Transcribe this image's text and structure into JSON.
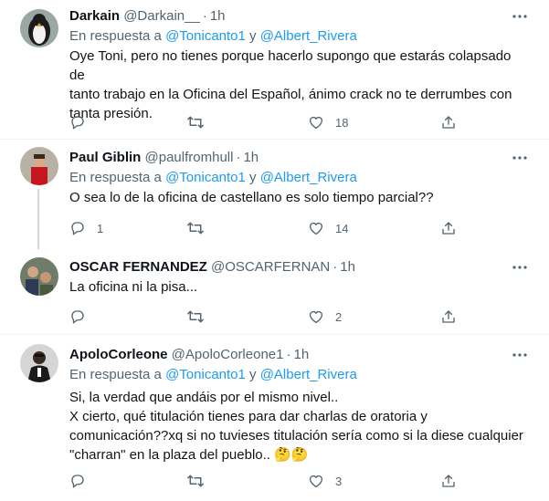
{
  "tweets": [
    {
      "name": "Darkain",
      "handle": "@Darkain__",
      "dot": "·",
      "time": "1h",
      "reply_prefix": "En respuesta a",
      "reply_mention1": "@Tonicanto1",
      "reply_joiner": " y ",
      "reply_mention2": "@Albert_Rivera",
      "lines": [
        "Oye Toni, pero no tienes porque hacerlo supongo que estarás colapsado de",
        "tanto trabajo en la Oficina del Español, ánimo crack no te derrumbes con",
        "tanta presión."
      ],
      "reply_count": "",
      "retweet_count": "",
      "like_count": "18"
    },
    {
      "name": "Paul Giblin",
      "handle": "@paulfromhull",
      "dot": "·",
      "time": "1h",
      "reply_prefix": "En respuesta a",
      "reply_mention1": "@Tonicanto1",
      "reply_joiner": " y ",
      "reply_mention2": "@Albert_Rivera",
      "lines": [
        "O sea lo de la oficina de castellano es solo tiempo parcial??"
      ],
      "reply_count": "1",
      "retweet_count": "",
      "like_count": "14"
    },
    {
      "name": "OSCAR FERNANDEZ",
      "handle": "@OSCARFERNAN",
      "dot": "·",
      "time": "1h",
      "lines": [
        "La oficina ni la pisa..."
      ],
      "reply_count": "",
      "retweet_count": "",
      "like_count": "2"
    },
    {
      "name": "ApoloCorleone",
      "handle": "@ApoloCorleone1",
      "dot": "·",
      "time": "1h",
      "reply_prefix": "En respuesta a",
      "reply_mention1": "@Tonicanto1",
      "reply_joiner": " y ",
      "reply_mention2": "@Albert_Rivera",
      "lines": [
        "Si, la verdad que andáis por el mismo nivel..",
        "X cierto, qué titulación tienes para dar charlas de oratoria y",
        "comunicación??xq si no tuvieses titulación sería como si la diese cualquier",
        "\"charran\" en la plaza del pueblo.."
      ],
      "emoji": "🤔🤔",
      "reply_count": "",
      "retweet_count": "",
      "like_count": "3"
    }
  ],
  "colors": {
    "text": "#0f1419",
    "secondary": "#536471",
    "link": "#1d9bf0",
    "separator": "#eff3f4",
    "thread_line": "#cfd9de"
  },
  "icons": [
    "reply-icon",
    "retweet-icon",
    "like-icon",
    "share-icon",
    "more-icon"
  ]
}
